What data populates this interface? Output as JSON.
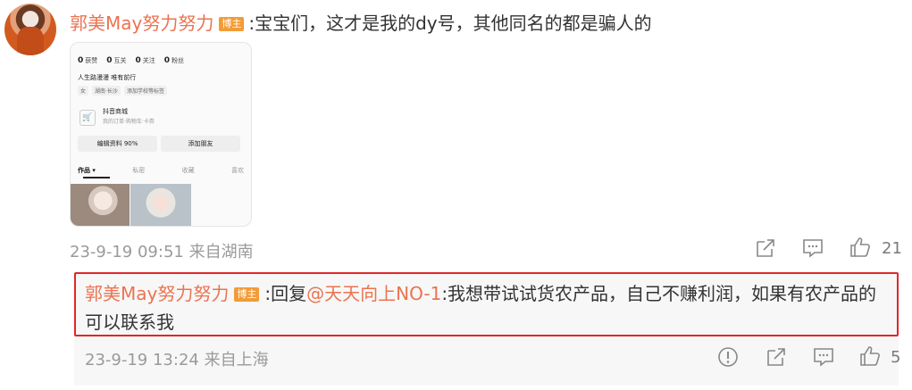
{
  "comment": {
    "author": "郭美May努力努力",
    "badge": "博主",
    "text": ":宝宝们，这才是我的dy号，其他同名的都是骗人的",
    "meta": "23-9-19 09:51 来自湖南",
    "like_count": "21"
  },
  "screenshot": {
    "stats": [
      {
        "num": "0",
        "label": "获赞"
      },
      {
        "num": "0",
        "label": "互关"
      },
      {
        "num": "0",
        "label": "关注"
      },
      {
        "num": "0",
        "label": "粉丝"
      }
    ],
    "bio": "人生路漫漫 唯有前行",
    "tags": [
      "女",
      "湖南·长沙",
      "添加学校等标签"
    ],
    "shop_title": "抖音商城",
    "shop_sub": "我的订单·购物车·卡券",
    "btn_edit": "编辑资料 90%",
    "btn_add": "添加朋友",
    "tabs": [
      "作品 ▾",
      "私密",
      "收藏",
      "喜欢"
    ]
  },
  "reply": {
    "author": "郭美May努力努力",
    "badge": "博主",
    "prefix": ":回复",
    "mention": "@天天向上NO-1",
    "text": ":我想带试试货农产品，自己不赚利润，如果有农产品的可以联系我",
    "meta": "23-9-19 13:24 来自上海",
    "like_count": "5"
  },
  "icons": {
    "share": "share-icon",
    "comment": "comment-icon",
    "like": "thumbs-up-icon",
    "report": "report-icon"
  }
}
